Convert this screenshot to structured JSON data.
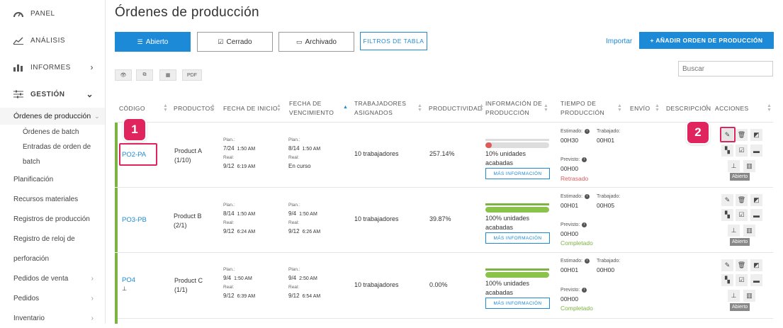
{
  "sidebar": {
    "top_items": [
      {
        "label": "PANEL",
        "icon": "gauge-icon"
      },
      {
        "label": "ANÁLISIS",
        "icon": "chart-icon"
      },
      {
        "label": "INFORMES",
        "icon": "bar-chart-icon",
        "chevron": "›"
      },
      {
        "label": "GESTIÓN",
        "icon": "sliders-icon",
        "chevron": "⌄"
      }
    ],
    "active_item": "Órdenes de producción",
    "sub_items": [
      "Órdenes de batch",
      "Entradas de orden de",
      "batch"
    ],
    "items": [
      {
        "label": "Planificación",
        "chevron": ""
      },
      {
        "label": "Recursos materiales",
        "chevron": ""
      },
      {
        "label": "Registros de producción",
        "chevron": ""
      },
      {
        "label": "Registro de reloj de",
        "chevron": ""
      },
      {
        "label": "perforación",
        "chevron": ""
      },
      {
        "label": "Pedidos de venta",
        "chevron": "›"
      },
      {
        "label": "Pedidos",
        "chevron": "›"
      },
      {
        "label": "Inventario",
        "chevron": "›"
      }
    ]
  },
  "header": {
    "title": "Órdenes de producción"
  },
  "toolbar": {
    "tab_open": "Abierto",
    "tab_closed": "Cerrado",
    "tab_archived": "Archivado",
    "filters": "FILTROS DE TABLA",
    "import": "Importar",
    "add_order": "+ AÑADIR ORDEN DE PRODUCCIÓN",
    "pdf": "PDF"
  },
  "search": {
    "placeholder": "Buscar"
  },
  "table": {
    "headers": {
      "code": "CÓDIGO",
      "products": "PRODUCTOS",
      "start_1": "FECHA DE INICIO",
      "due_1": "FECHA DE",
      "due_2": "VENCIMIENTO",
      "workers_1": "TRABAJADORES",
      "workers_2": "ASIGNADOS",
      "productivity": "PRODUCTIVIDAD",
      "info_1": "INFORMACIÓN DE",
      "info_2": "PRODUCCIÓN",
      "time_1": "TIEMPO DE",
      "time_2": "PRODUCCIÓN",
      "shipping": "ENVÍO",
      "description": "DESCRIPCIÓN",
      "actions": "ACCIONES"
    },
    "labels": {
      "plan": "Plan.:",
      "real": "Real:",
      "estimated": "Estimado:",
      "worked": "Trabajado:",
      "expected": "Previsto:",
      "more_info": "MÁS INFORMACIÓN",
      "open_badge": "Abierto"
    },
    "rows": [
      {
        "code": "PO2-PA",
        "product": "Product A",
        "product_qty": "(1/10)",
        "start_plan_date": "7/24",
        "start_plan_time": "1:50 AM",
        "start_real_date": "9/12",
        "start_real_time": "6:19 AM",
        "due_plan_date": "8/14",
        "due_plan_time": "1:50 AM",
        "due_real": "En curso",
        "workers": "10 trabajadores",
        "productivity": "257.14%",
        "progress_pct": 10,
        "progress_text_1": "10% unidades",
        "progress_text_2": "acabadas",
        "estimated": "00H30",
        "worked": "00H01",
        "expected": "00H00",
        "status": "Retrasado"
      },
      {
        "code": "PO3-PB",
        "product": "Product B",
        "product_qty": "(2/1)",
        "start_plan_date": "8/14",
        "start_plan_time": "1:50 AM",
        "start_real_date": "9/12",
        "start_real_time": "6:24 AM",
        "due_plan_date": "9/4",
        "due_plan_time": "1:50 AM",
        "due_real_date": "9/12",
        "due_real_time": "6:26 AM",
        "workers": "10 trabajadores",
        "productivity": "39.87%",
        "progress_pct": 100,
        "progress_text_1": "100% unidades",
        "progress_text_2": "acabadas",
        "estimated": "00H01",
        "worked": "00H05",
        "expected": "00H00",
        "status": "Completado"
      },
      {
        "code": "PO4",
        "product": "Product C",
        "product_qty": "(1/1)",
        "start_plan_date": "9/4",
        "start_plan_time": "1:50 AM",
        "start_real_date": "9/12",
        "start_real_time": "6:39 AM",
        "due_plan_date": "9/4",
        "due_plan_time": "2:50 AM",
        "due_real_date": "9/12",
        "due_real_time": "6:54 AM",
        "workers": "10 trabajadores",
        "productivity": "0.00%",
        "progress_pct": 100,
        "progress_text_1": "100% unidades",
        "progress_text_2": "acabadas",
        "estimated": "00H01",
        "worked": "00H00",
        "expected": "00H00",
        "status": "Completado"
      }
    ]
  },
  "annotations": {
    "marker_1": "1",
    "marker_2": "2"
  },
  "colors": {
    "accent": "#1c8ad6",
    "success": "#7cb342",
    "danger": "#e05a5a",
    "marker": "#e0245e"
  }
}
